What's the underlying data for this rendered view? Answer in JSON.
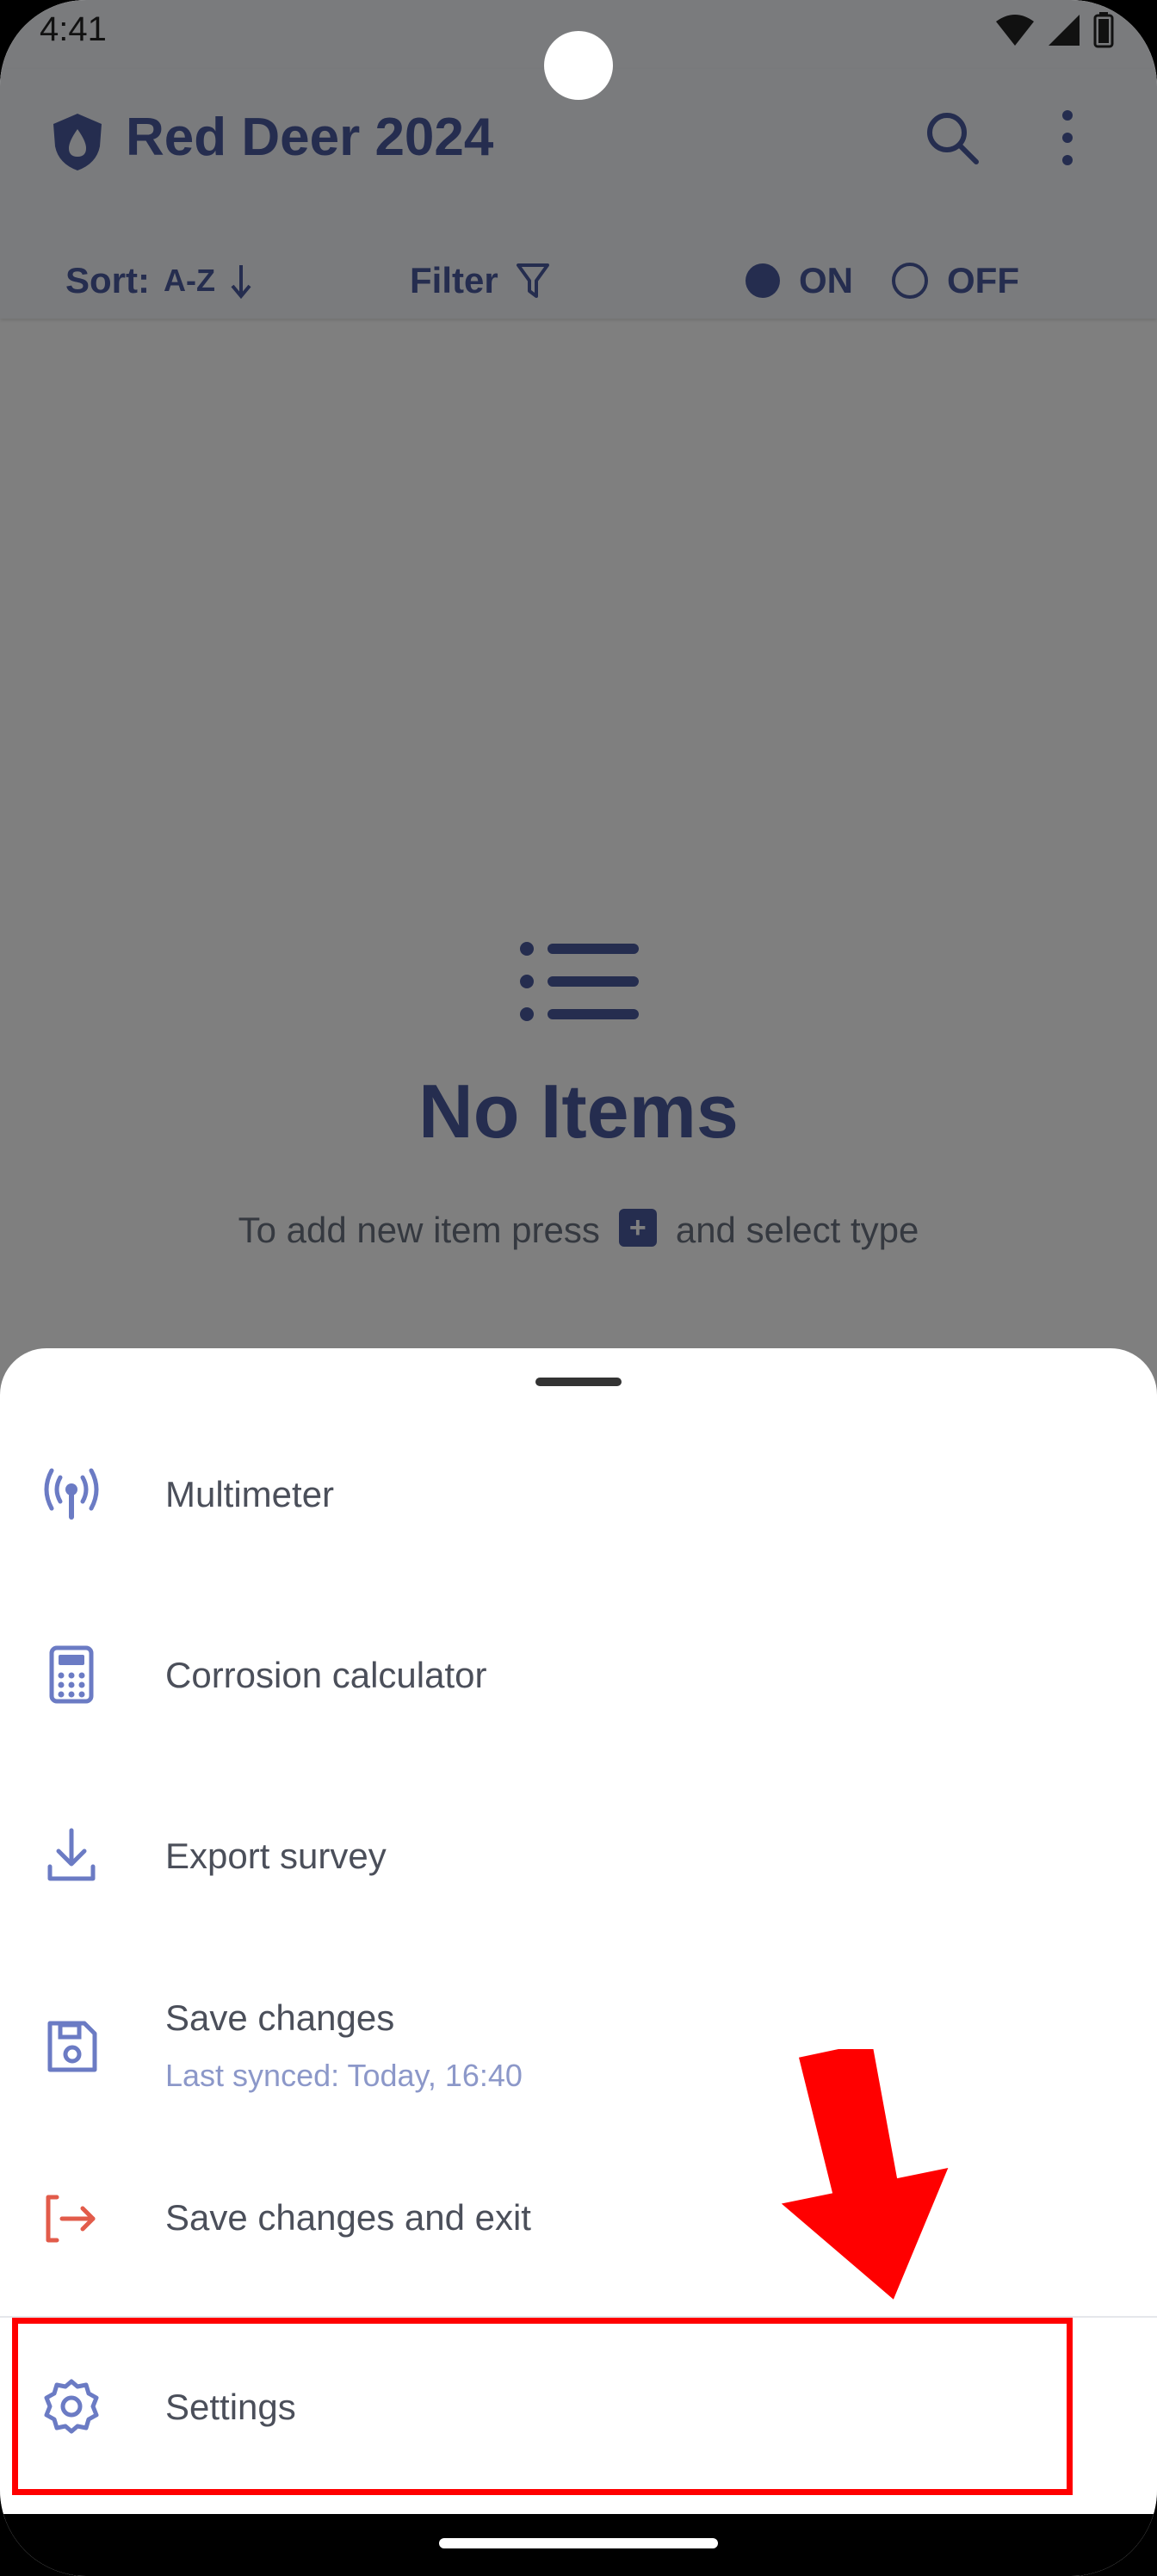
{
  "status_bar": {
    "time": "4:41"
  },
  "app_bar": {
    "title": "Red Deer 2024",
    "logo_icon": "shield-drop-icon",
    "search_icon": "search-icon",
    "more_icon": "more-vertical-icon"
  },
  "toolbar": {
    "sort_label": "Sort:",
    "sort_value": "A-Z",
    "filter_label": "Filter",
    "radio_on_label": "ON",
    "radio_off_label": "OFF",
    "radio_selected": "ON"
  },
  "empty_state": {
    "title": "No Items",
    "hint_before": "To add new item press",
    "hint_after": "and select type",
    "plus_glyph": "+"
  },
  "menu": {
    "items": [
      {
        "label": "Multimeter",
        "icon": "antenna-icon"
      },
      {
        "label": "Corrosion calculator",
        "icon": "calculator-icon"
      },
      {
        "label": "Export survey",
        "icon": "download-icon"
      },
      {
        "label": "Save changes",
        "sublabel": "Last synced: Today, 16:40",
        "icon": "save-icon"
      },
      {
        "label": "Save changes and exit",
        "icon": "exit-icon"
      },
      {
        "label": "Settings",
        "icon": "gear-icon"
      }
    ]
  },
  "colors": {
    "accent": "#4a5a9e",
    "menu_icon": "#6b7bc4",
    "exit_icon": "#e25b4a",
    "highlight": "#ff0000"
  }
}
